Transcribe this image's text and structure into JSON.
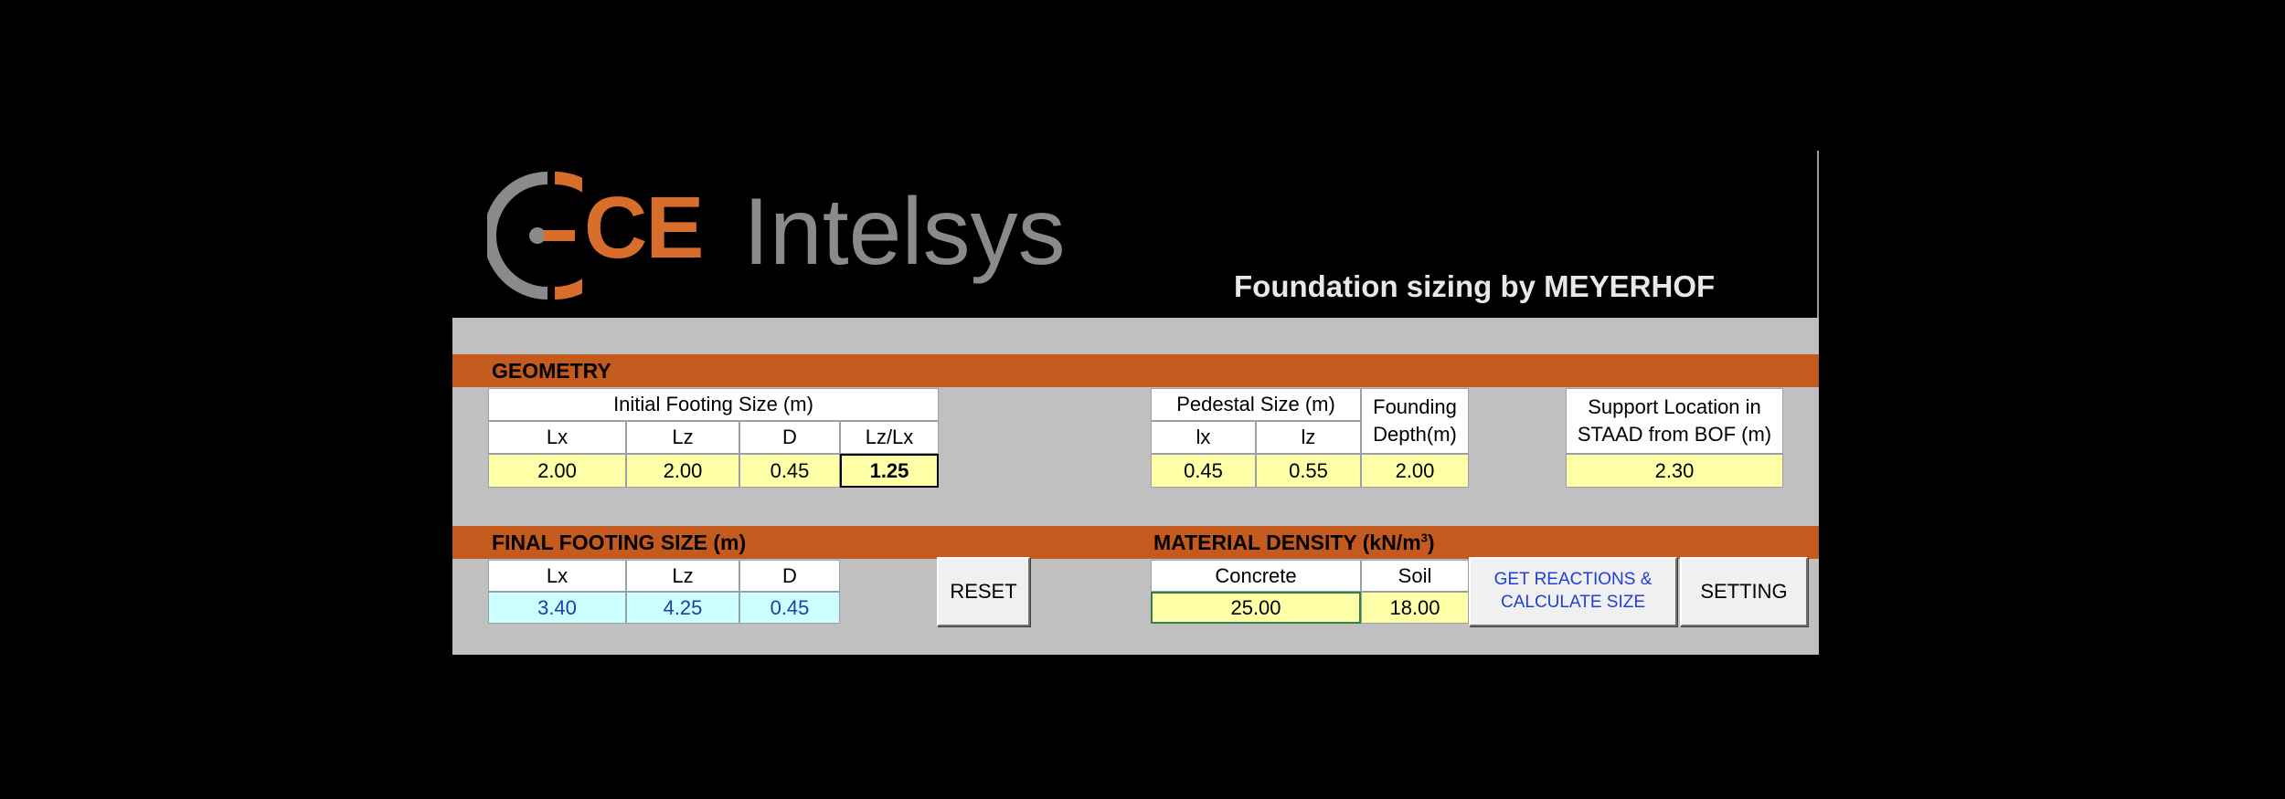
{
  "header": {
    "logo_text": "CE Intelsys",
    "logo_ce": "CE",
    "logo_intelsys": "Intelsys",
    "subtitle": "Foundation sizing by MEYERHOF"
  },
  "geometry": {
    "label": "GEOMETRY",
    "initial_footing": {
      "title": "Initial Footing Size (m)",
      "cols": [
        "Lx",
        "Lz",
        "D",
        "Lz/Lx"
      ],
      "values": [
        "2.00",
        "2.00",
        "0.45",
        "1.25"
      ]
    },
    "pedestal": {
      "title": "Pedestal Size (m)",
      "cols": [
        "lx",
        "lz"
      ],
      "values": [
        "0.45",
        "0.55"
      ]
    },
    "founding_depth": {
      "title_line1": "Founding",
      "title_line2": "Depth(m)",
      "value": "2.00"
    },
    "support_location": {
      "title_line1": "Support Location in",
      "title_line2": "STAAD from BOF (m)",
      "value": "2.30"
    }
  },
  "final_footing": {
    "label": "FINAL FOOTING SIZE (m)",
    "cols": [
      "Lx",
      "Lz",
      "D"
    ],
    "values": [
      "3.40",
      "4.25",
      "0.45"
    ]
  },
  "material_density": {
    "label": "MATERIAL DENSITY (kN/m",
    "label_sup": "3",
    "label_end": ")",
    "cols": [
      "Concrete",
      "Soil"
    ],
    "values": [
      "25.00",
      "18.00"
    ]
  },
  "buttons": {
    "reset": "RESET",
    "calc_line1": "GET REACTIONS &",
    "calc_line2": "CALCULATE SIZE",
    "setting": "SETTING"
  },
  "colors": {
    "accent": "#c55a1f",
    "input_yellow": "#ffffa8",
    "result_cyan": "#ccffff",
    "panel_gray": "#c0c0c0"
  }
}
